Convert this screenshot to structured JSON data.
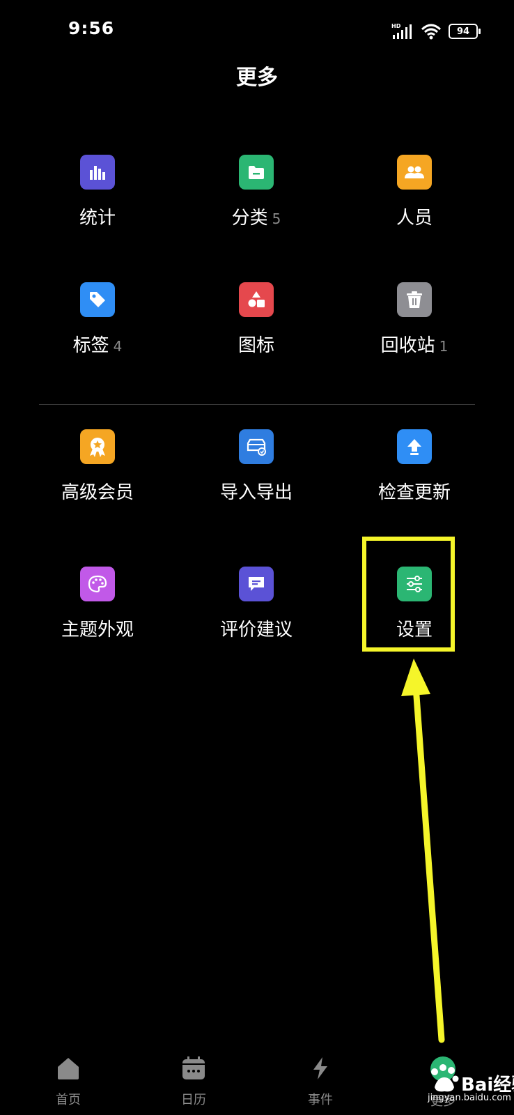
{
  "status": {
    "time": "9:56",
    "network": "HD",
    "battery": "94"
  },
  "page": {
    "title": "更多"
  },
  "grid": {
    "stats": {
      "label": "统计",
      "icon": "chart-icon",
      "color": "#5b52d6"
    },
    "category": {
      "label": "分类",
      "count": "5",
      "icon": "folder-icon",
      "color": "#2bb673"
    },
    "people": {
      "label": "人员",
      "icon": "people-icon",
      "color": "#f5a623"
    },
    "tags": {
      "label": "标签",
      "count": "4",
      "icon": "tag-icon",
      "color": "#2f8ef5"
    },
    "icons": {
      "label": "图标",
      "icon": "shapes-icon",
      "color": "#e5484d"
    },
    "trash": {
      "label": "回收站",
      "count": "1",
      "icon": "trash-icon",
      "color": "#8e8e93"
    },
    "vip": {
      "label": "高级会员",
      "icon": "medal-icon",
      "color": "#f5a623"
    },
    "import_export": {
      "label": "导入导出",
      "icon": "sync-drive-icon",
      "color": "#2f7de0"
    },
    "update": {
      "label": "检查更新",
      "icon": "upload-icon",
      "color": "#2f8ef5"
    },
    "theme": {
      "label": "主题外观",
      "icon": "palette-icon",
      "color": "#c159e8"
    },
    "feedback": {
      "label": "评价建议",
      "icon": "chat-icon",
      "color": "#5b52d6"
    },
    "settings": {
      "label": "设置",
      "icon": "sliders-icon",
      "color": "#2bb673"
    }
  },
  "nav": {
    "home": "首页",
    "calendar": "日历",
    "events": "事件",
    "more": "更多"
  },
  "watermark": {
    "brand": "Bai",
    "brand2": "经验",
    "site": "jingyan.baidu.com"
  },
  "colors": {
    "highlight": "#f5f52a",
    "background": "#000000"
  }
}
